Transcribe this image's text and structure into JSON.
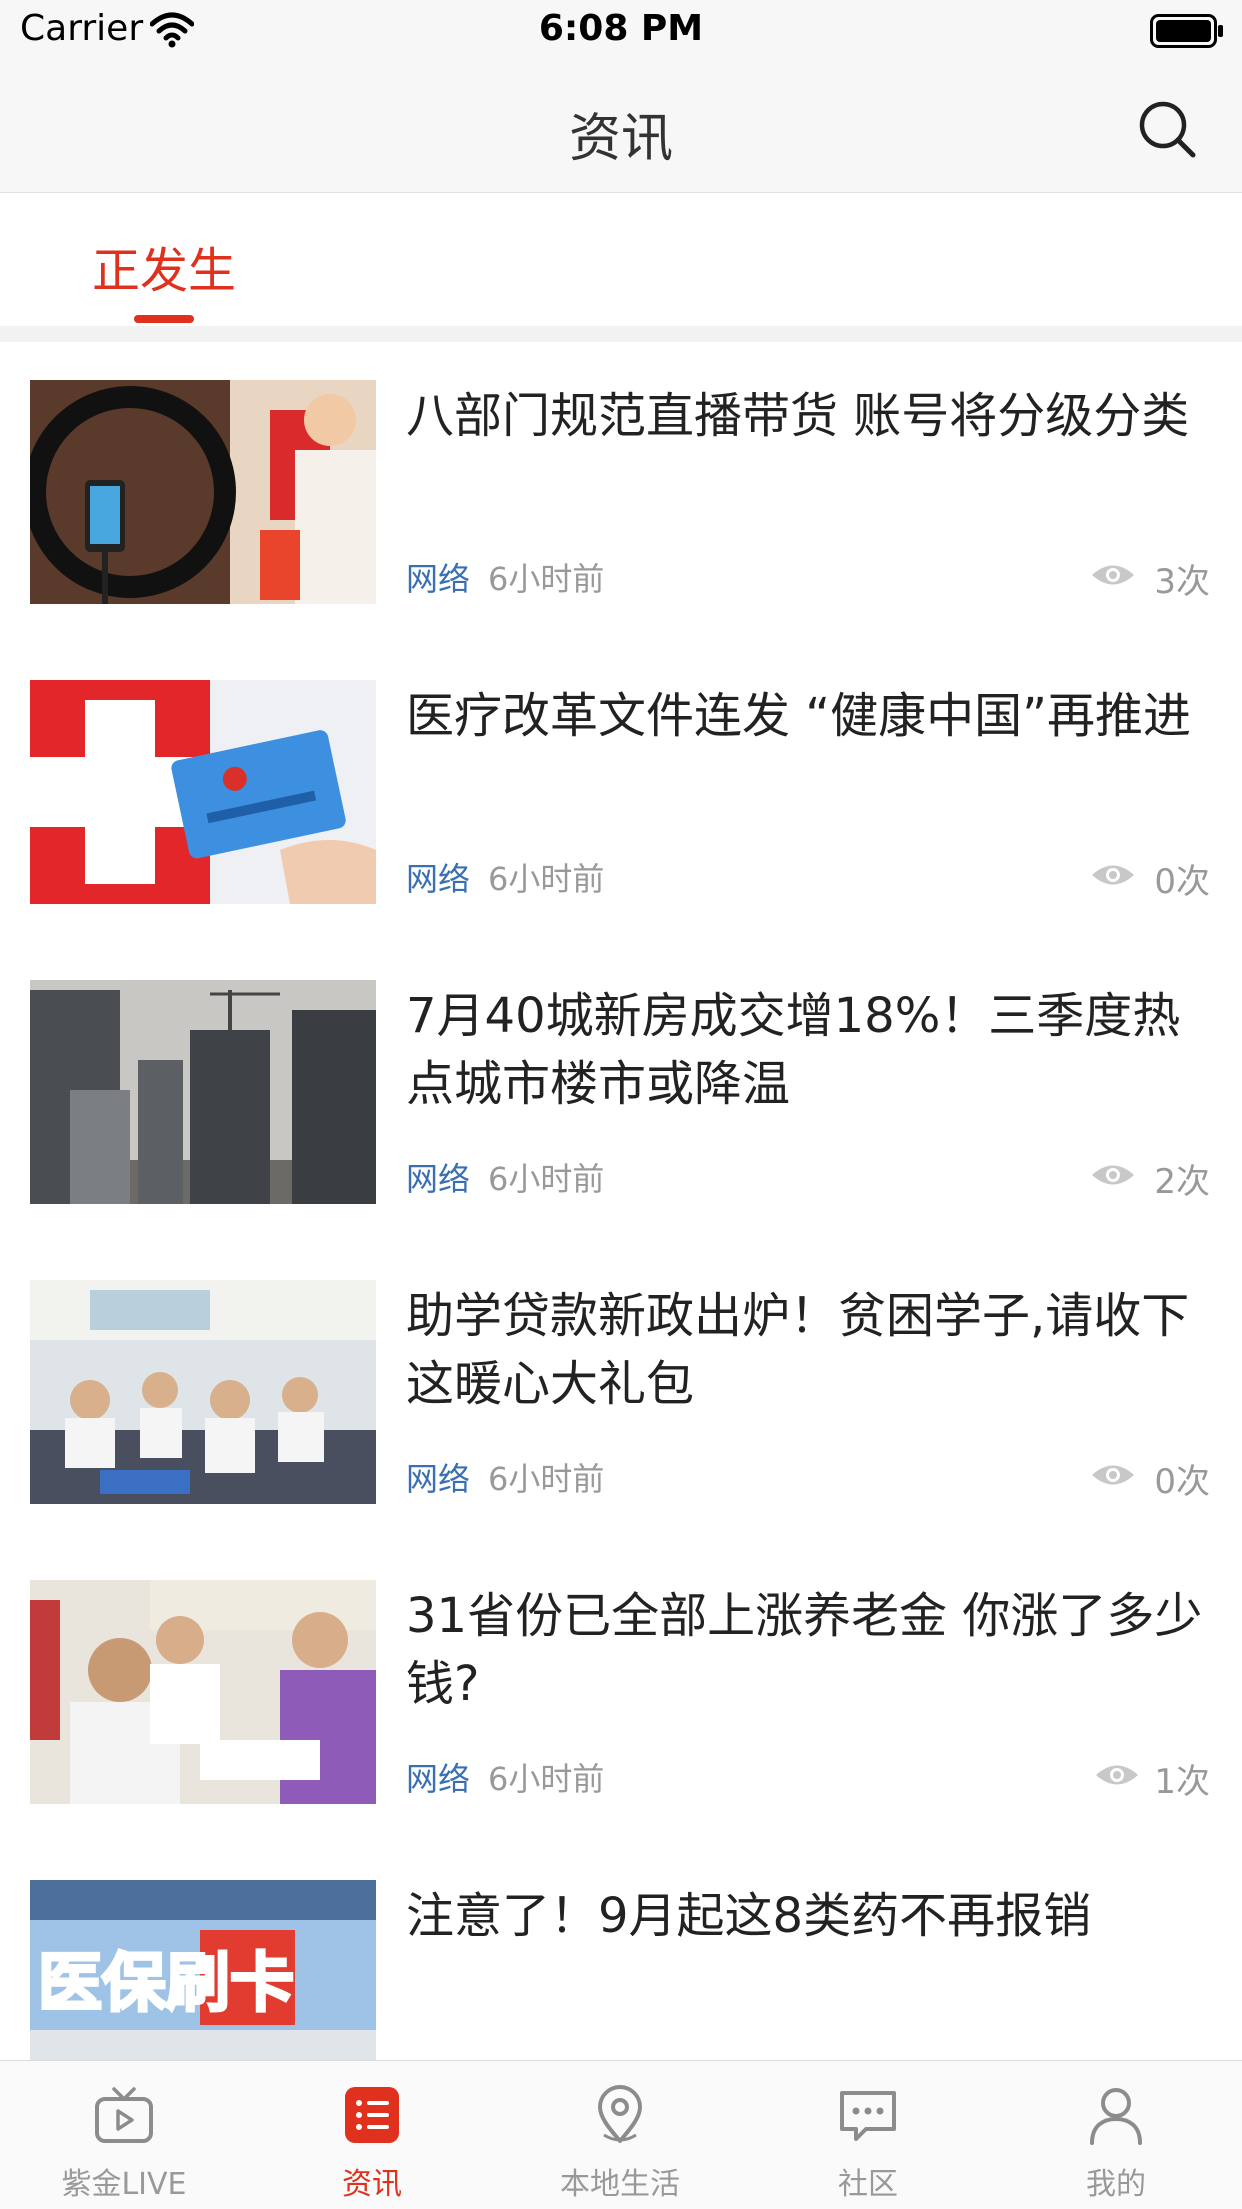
{
  "status_bar": {
    "carrier": "Carrier",
    "time": "6:08 PM"
  },
  "nav": {
    "title": "资讯",
    "search_icon": "search-icon"
  },
  "sub_tabs": [
    {
      "label": "正发生",
      "active": true
    }
  ],
  "colors": {
    "accent": "#e0301e",
    "source_blue": "#3a6fb3",
    "meta_gray": "#999999"
  },
  "news": [
    {
      "title": "八部门规范直播带货 账号将分级分类",
      "source": "网络",
      "time": "6小时前",
      "views": "3次",
      "thumb": "livestream"
    },
    {
      "title": "医疗改革文件连发 “健康中国”再推进",
      "source": "网络",
      "time": "6小时前",
      "views": "0次",
      "thumb": "medical-card"
    },
    {
      "title": "7月40城新房成交增18%！三季度热点城市楼市或降温",
      "source": "网络",
      "time": "6小时前",
      "views": "2次",
      "thumb": "buildings"
    },
    {
      "title": "助学贷款新政出炉！贫困学子,请收下这暖心大礼包",
      "source": "网络",
      "time": "6小时前",
      "views": "0次",
      "thumb": "classroom"
    },
    {
      "title": "31省份已全部上涨养老金 你涨了多少钱?",
      "source": "网络",
      "time": "6小时前",
      "views": "1次",
      "thumb": "pension"
    },
    {
      "title": "注意了！9月起这8类药不再报销",
      "thumb": "pharmacy",
      "thumb_text": "医保刷卡"
    }
  ],
  "tab_bar": [
    {
      "label": "紫金LIVE",
      "icon": "tv-icon",
      "active": false
    },
    {
      "label": "资讯",
      "icon": "list-icon",
      "active": true
    },
    {
      "label": "本地生活",
      "icon": "location-pin-icon",
      "active": false
    },
    {
      "label": "社区",
      "icon": "chat-bubble-icon",
      "active": false
    },
    {
      "label": "我的",
      "icon": "person-icon",
      "active": false
    }
  ]
}
